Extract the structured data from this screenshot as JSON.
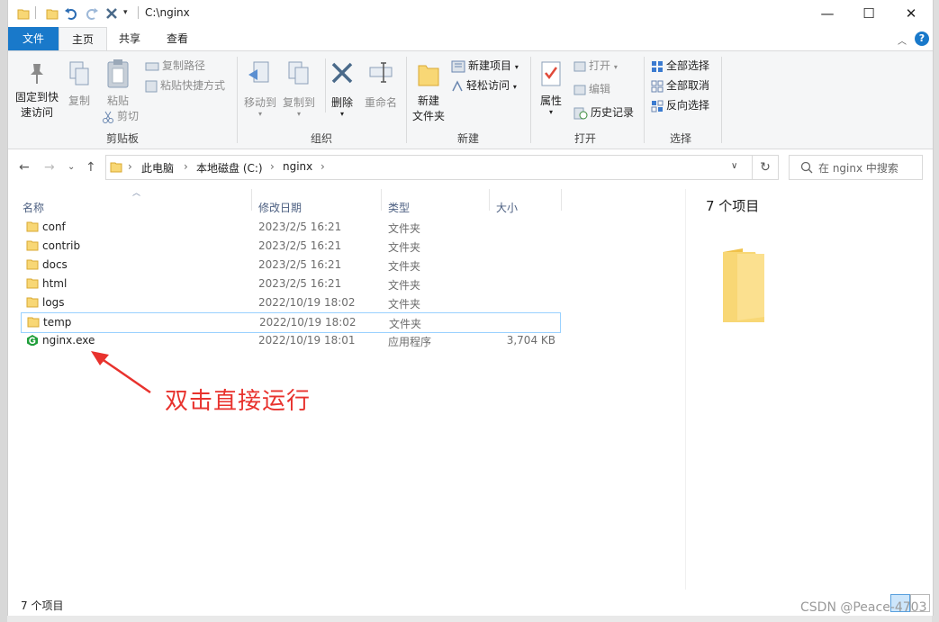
{
  "window": {
    "title": "C:\\nginx",
    "minimize": "—",
    "maximize": "☐",
    "close": "✕",
    "help_icon": "?"
  },
  "tabs": [
    {
      "label": "文件"
    },
    {
      "label": "主页"
    },
    {
      "label": "共享"
    },
    {
      "label": "查看"
    }
  ],
  "ribbon": {
    "clipboard": {
      "pin": "固定到快\n速访问",
      "pin_l1": "固定到快",
      "pin_l2": "速访问",
      "copy": "复制",
      "paste": "粘贴",
      "copy_path": "复制路径",
      "paste_shortcut": "粘贴快捷方式",
      "cut": "剪切",
      "label": "剪贴板"
    },
    "organize": {
      "move_to": "移动到",
      "copy_to": "复制到",
      "delete": "删除",
      "rename": "重命名",
      "label": "组织"
    },
    "new": {
      "new_folder_l1": "新建",
      "new_folder_l2": "文件夹",
      "new_item": "新建项目",
      "easy_access": "轻松访问",
      "label": "新建"
    },
    "open": {
      "properties": "属性",
      "open": "打开",
      "edit": "编辑",
      "history": "历史记录",
      "label": "打开"
    },
    "select": {
      "select_all": "全部选择",
      "select_none": "全部取消",
      "invert": "反向选择",
      "label": "选择"
    }
  },
  "address": {
    "crumbs": [
      "此电脑",
      "本地磁盘 (C:)",
      "nginx"
    ],
    "search_placeholder": "在 nginx 中搜索"
  },
  "columns": {
    "name": "名称",
    "modified": "修改日期",
    "type": "类型",
    "size": "大小"
  },
  "files": [
    {
      "name": "conf",
      "modified": "2023/2/5 16:21",
      "type": "文件夹",
      "size": "",
      "icon": "folder-icon"
    },
    {
      "name": "contrib",
      "modified": "2023/2/5 16:21",
      "type": "文件夹",
      "size": "",
      "icon": "folder-icon"
    },
    {
      "name": "docs",
      "modified": "2023/2/5 16:21",
      "type": "文件夹",
      "size": "",
      "icon": "folder-icon"
    },
    {
      "name": "html",
      "modified": "2023/2/5 16:21",
      "type": "文件夹",
      "size": "",
      "icon": "folder-icon"
    },
    {
      "name": "logs",
      "modified": "2022/10/19 18:02",
      "type": "文件夹",
      "size": "",
      "icon": "folder-icon"
    },
    {
      "name": "temp",
      "modified": "2022/10/19 18:02",
      "type": "文件夹",
      "size": "",
      "icon": "folder-icon"
    },
    {
      "name": "nginx.exe",
      "modified": "2022/10/19 18:01",
      "type": "应用程序",
      "size": "3,704 KB",
      "icon": "nginx-app-icon"
    }
  ],
  "preview": {
    "count_title": "7 个项目"
  },
  "status": {
    "count": "7 个项目"
  },
  "annotation": {
    "text": "双击直接运行"
  },
  "watermark": "CSDN @Peace-4703",
  "colors": {
    "accent": "#1979ca",
    "annotation": "#e8322d",
    "folder": "#f8d775",
    "selection_border": "#99d1ff"
  }
}
